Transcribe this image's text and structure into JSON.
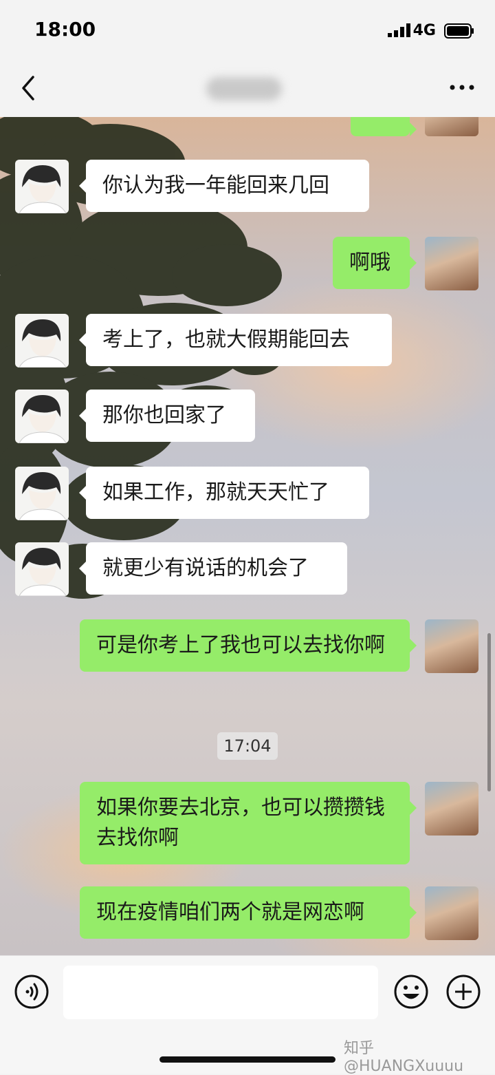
{
  "status_bar": {
    "time": "18:00",
    "network": "4G"
  },
  "nav": {
    "title": ""
  },
  "messages": [
    {
      "side": "right",
      "text": ""
    },
    {
      "side": "left",
      "text": "你认为我一年能回来几回"
    },
    {
      "side": "right",
      "text": "啊哦"
    },
    {
      "side": "left",
      "text": "考上了，也就大假期能回去"
    },
    {
      "side": "left",
      "text": "那你也回家了"
    },
    {
      "side": "left",
      "text": "如果工作，那就天天忙了"
    },
    {
      "side": "left",
      "text": "就更少有说话的机会了"
    },
    {
      "side": "right",
      "text": "可是你考上了我也可以去找你啊"
    },
    {
      "side": "right",
      "text": "如果你要去北京，也可以攒攒钱去找你啊"
    },
    {
      "side": "right",
      "text": "现在疫情咱们两个就是网恋啊"
    }
  ],
  "timestamp": "17:04",
  "watermark": "知乎 @HUANGXuuuu",
  "colors": {
    "bubble_green": "#95ec69",
    "bubble_white": "#ffffff"
  }
}
